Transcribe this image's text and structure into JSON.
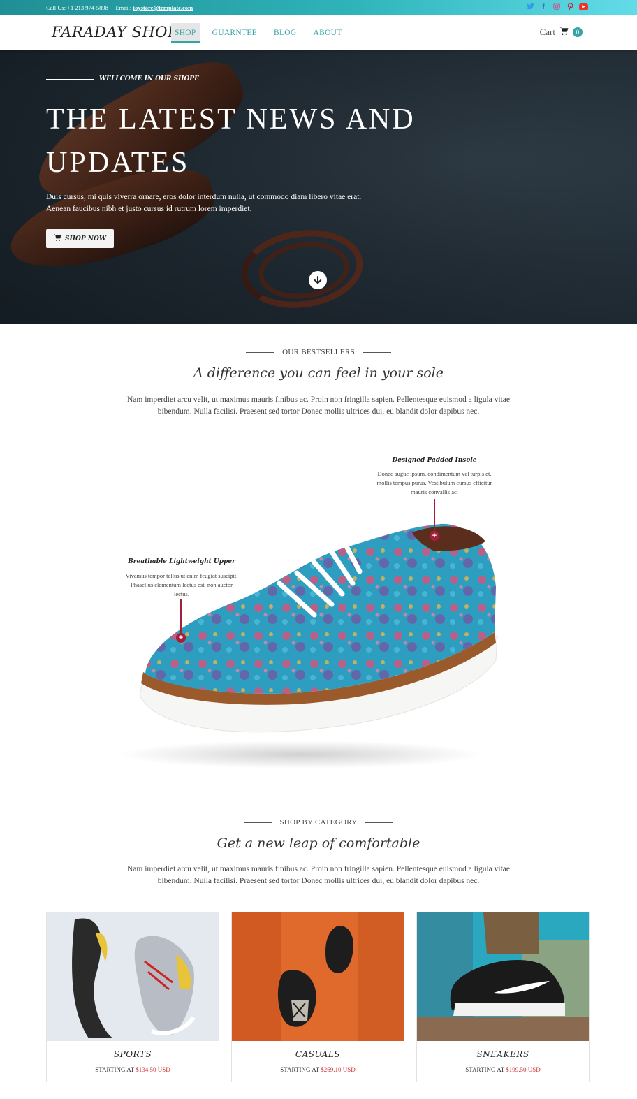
{
  "topbar": {
    "call": "Call Us: +1 213 974-5898",
    "email_label": "Email:",
    "email": "toystore@template.com",
    "social": [
      "twitter-icon",
      "facebook-icon",
      "instagram-icon",
      "pinterest-icon",
      "youtube-icon"
    ]
  },
  "nav": {
    "logo": "FARADAY SHOES",
    "menu": [
      "SHOP",
      "GUARNTEE",
      "BLOG",
      "ABOUT"
    ],
    "active": "SHOP",
    "cart_label": "Cart",
    "cart_count": "0"
  },
  "hero": {
    "kicker": "WELLCOME IN OUR SHOPE",
    "title_line1": "THE LATEST NEWS AND",
    "title_line2": "UPDATES",
    "text_line1": "Duis cursus, mi quis viverra ornare, eros dolor interdum nulla, ut commodo diam libero vitae erat.",
    "text_line2": "Aenean faucibus nibh et justo cursus id rutrum lorem imperdiet.",
    "button": "SHOP NOW"
  },
  "bestsellers": {
    "kicker": "OUR BESTSELLERS",
    "title": "A difference you can feel in your sole",
    "text_line1": "Nam imperdiet arcu velit, ut maximus mauris finibus ac. Proin non fringilla sapien. Pellentesque euismod a ligula vitae",
    "text_line2": "bibendum. Nulla facilisi. Praesent sed tortor Donec mollis ultrices dui, eu blandit dolor dapibus nec."
  },
  "callouts": {
    "insole": {
      "title": "Designed Padded Insole",
      "line1": "Donec augue ipsum, condimentum vel turpis et,",
      "line2": "mollis tempus purus. Vestibulum cursus efficitur",
      "line3": "mauris convallis ac."
    },
    "upper": {
      "title": "Breathable Lightweight Upper",
      "line1": "Vivamus tempor tellus ut enim feugiat suscipit.",
      "line2": "Phasellus elementum lectus est, non auctor",
      "line3": "lectus."
    }
  },
  "category": {
    "kicker": "SHOP BY CATEGORY",
    "title": "Get a new leap of comfortable",
    "text_line1": "Nam imperdiet arcu velit, ut maximus mauris finibus ac. Proin non fringilla sapien. Pellentesque euismod a ligula vitae",
    "text_line2": "bibendum. Nulla facilisi. Praesent sed tortor Donec mollis ultrices dui, eu blandit dolor dapibus nec.",
    "cards": [
      {
        "name": "SPORTS",
        "price_label": "STARTING AT",
        "price": "$134.50 USD"
      },
      {
        "name": "CASUALS",
        "price_label": "STARTING AT",
        "price": "$269.10 USD"
      },
      {
        "name": "SNEAKERS",
        "price_label": "STARTING AT",
        "price": "$199.50 USD"
      }
    ]
  },
  "colors": {
    "accent": "#36a3a8",
    "pin": "#a3203a",
    "price": "#d0353a"
  }
}
